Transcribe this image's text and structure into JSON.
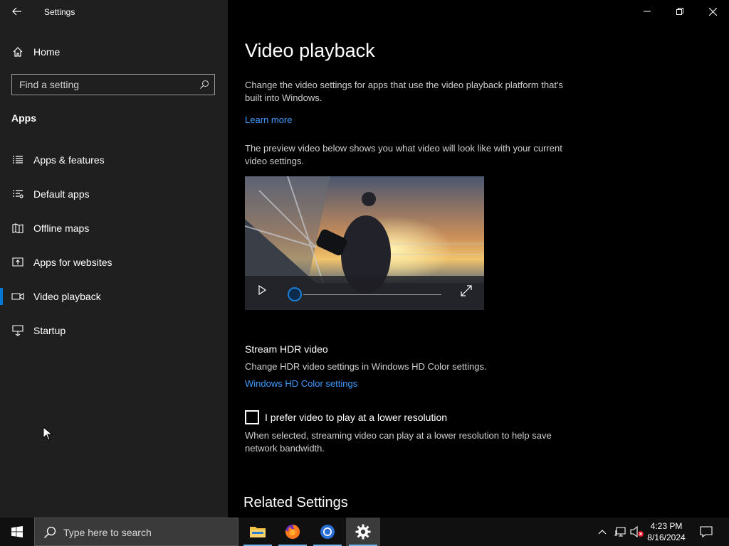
{
  "window": {
    "app_title": "Settings"
  },
  "sidebar": {
    "home_label": "Home",
    "search_placeholder": "Find a setting",
    "section_title": "Apps",
    "items": [
      {
        "label": "Apps & features",
        "icon": "list-icon"
      },
      {
        "label": "Default apps",
        "icon": "default-apps-icon"
      },
      {
        "label": "Offline maps",
        "icon": "map-icon"
      },
      {
        "label": "Apps for websites",
        "icon": "open-in-icon"
      },
      {
        "label": "Video playback",
        "icon": "video-icon",
        "selected": true
      },
      {
        "label": "Startup",
        "icon": "startup-icon"
      }
    ]
  },
  "main": {
    "title": "Video playback",
    "description": "Change the video settings for apps that use the video playback platform that's built into Windows.",
    "learn_more": "Learn more",
    "preview_text": "The preview video below shows you what video will look like with your current video settings.",
    "hdr": {
      "title": "Stream HDR video",
      "description": "Change HDR video settings in Windows HD Color settings.",
      "link": "Windows HD Color settings"
    },
    "low_res": {
      "label": "I prefer video to play at a lower resolution",
      "checked": false,
      "description": "When selected, streaming video can play at a lower resolution to help save network bandwidth."
    },
    "related_title": "Related Settings"
  },
  "taskbar": {
    "search_placeholder": "Type here to search",
    "apps": [
      "file-explorer-icon",
      "firefox-icon",
      "chrome-icon",
      "settings-icon"
    ],
    "time": "4:23 PM",
    "date": "8/16/2024"
  },
  "colors": {
    "accent": "#0078d7",
    "link": "#3e9aff",
    "sidebar_bg": "#1f1f1f"
  }
}
